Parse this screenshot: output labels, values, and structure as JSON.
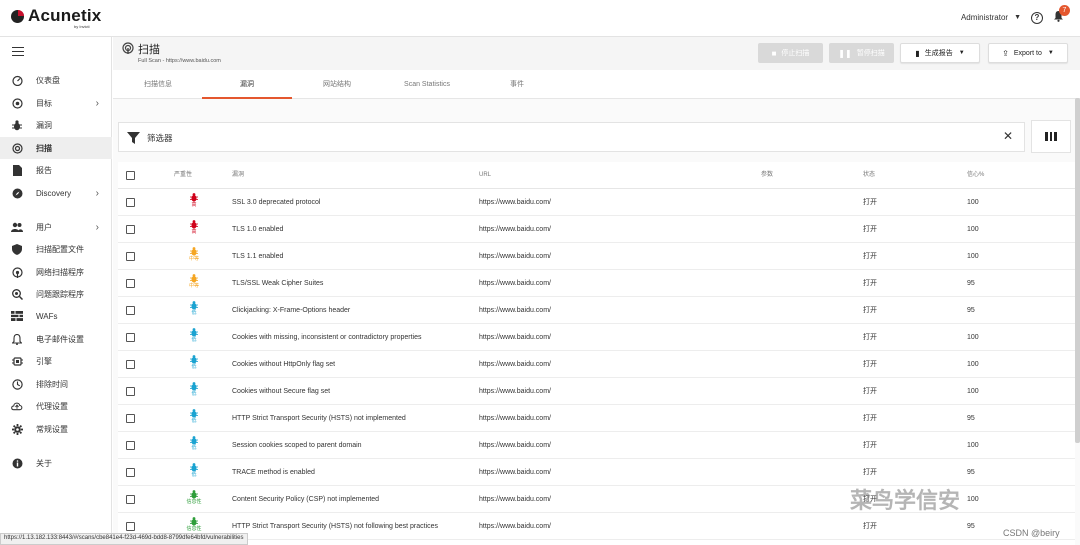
{
  "app": {
    "logo_text": "Acunetix",
    "logo_sub": "by Invicti",
    "user": "Administrator",
    "help_icon": "help-icon",
    "notifications": "7"
  },
  "sidebar": {
    "items": [
      {
        "label": "仪表盘",
        "icon": "dashboard-icon"
      },
      {
        "label": "目标",
        "icon": "target-icon",
        "arrow": "›"
      },
      {
        "label": "漏洞",
        "icon": "bug-icon"
      },
      {
        "label": "扫描",
        "icon": "scan-icon",
        "active": true
      },
      {
        "label": "报告",
        "icon": "report-icon"
      },
      {
        "label": "Discovery",
        "icon": "compass-icon",
        "arrow": "›"
      },
      {
        "label": "用户",
        "icon": "users-icon",
        "arrow": "›"
      },
      {
        "label": "扫描配置文件",
        "icon": "shield-icon"
      },
      {
        "label": "网络扫描程序",
        "icon": "network-scanner-icon"
      },
      {
        "label": "问题跟踪程序",
        "icon": "issue-tracker-icon"
      },
      {
        "label": "WAFs",
        "icon": "firewall-icon"
      },
      {
        "label": "电子邮件设置",
        "icon": "bell-icon"
      },
      {
        "label": "引擎",
        "icon": "engine-icon"
      },
      {
        "label": "排除时间",
        "icon": "clock-icon"
      },
      {
        "label": "代理设置",
        "icon": "cloud-proxy-icon"
      },
      {
        "label": "常规设置",
        "icon": "gear-icon"
      },
      {
        "label": "关于",
        "icon": "info-icon"
      }
    ]
  },
  "page": {
    "title": "扫描",
    "subtitle": "Full Scan - https://www.baidu.com",
    "buttons": {
      "stop": "停止扫描",
      "pause": "暂停扫描",
      "report": "生成报告",
      "export": "Export to"
    }
  },
  "tabs": [
    {
      "label": "扫描信息"
    },
    {
      "label": "漏洞",
      "active": true
    },
    {
      "label": "网站结构"
    },
    {
      "label": "Scan Statistics"
    },
    {
      "label": "事件"
    }
  ],
  "filter": {
    "label": "筛选器"
  },
  "table": {
    "headers": {
      "severity": "严重性",
      "vuln": "漏洞",
      "url": "URL",
      "params": "参数",
      "status": "状态",
      "confidence": "信心%"
    },
    "rows": [
      {
        "sev": "高",
        "color": "#d0021b",
        "vuln": "SSL 3.0 deprecated protocol",
        "url": "https://www.baidu.com/",
        "status": "打开",
        "conf": "100"
      },
      {
        "sev": "高",
        "color": "#d0021b",
        "vuln": "TLS 1.0 enabled",
        "url": "https://www.baidu.com/",
        "status": "打开",
        "conf": "100"
      },
      {
        "sev": "中等",
        "color": "#f5a623",
        "vuln": "TLS 1.1 enabled",
        "url": "https://www.baidu.com/",
        "status": "打开",
        "conf": "100"
      },
      {
        "sev": "中等",
        "color": "#f5a623",
        "vuln": "TLS/SSL Weak Cipher Suites",
        "url": "https://www.baidu.com/",
        "status": "打开",
        "conf": "95"
      },
      {
        "sev": "低",
        "color": "#1ba3d1",
        "vuln": "Clickjacking: X-Frame-Options header",
        "url": "https://www.baidu.com/",
        "status": "打开",
        "conf": "95"
      },
      {
        "sev": "低",
        "color": "#1ba3d1",
        "vuln": "Cookies with missing, inconsistent or contradictory properties",
        "url": "https://www.baidu.com/",
        "status": "打开",
        "conf": "100"
      },
      {
        "sev": "低",
        "color": "#1ba3d1",
        "vuln": "Cookies without HttpOnly flag set",
        "url": "https://www.baidu.com/",
        "status": "打开",
        "conf": "100"
      },
      {
        "sev": "低",
        "color": "#1ba3d1",
        "vuln": "Cookies without Secure flag set",
        "url": "https://www.baidu.com/",
        "status": "打开",
        "conf": "100"
      },
      {
        "sev": "低",
        "color": "#1ba3d1",
        "vuln": "HTTP Strict Transport Security (HSTS) not implemented",
        "url": "https://www.baidu.com/",
        "status": "打开",
        "conf": "95"
      },
      {
        "sev": "低",
        "color": "#1ba3d1",
        "vuln": "Session cookies scoped to parent domain",
        "url": "https://www.baidu.com/",
        "status": "打开",
        "conf": "100"
      },
      {
        "sev": "低",
        "color": "#1ba3d1",
        "vuln": "TRACE method is enabled",
        "url": "https://www.baidu.com/",
        "status": "打开",
        "conf": "95"
      },
      {
        "sev": "信息性",
        "color": "#2e9e3a",
        "vuln": "Content Security Policy (CSP) not implemented",
        "url": "https://www.baidu.com/",
        "status": "打开",
        "conf": "100"
      },
      {
        "sev": "信息性",
        "color": "#2e9e3a",
        "vuln": "HTTP Strict Transport Security (HSTS) not following best practices",
        "url": "https://www.baidu.com/",
        "status": "打开",
        "conf": "95"
      }
    ]
  },
  "status_url": "https://1.13.182.133:8443/#/scans/cbe841e4-f23d-469d-bdd8-8799dfe64bfd/vulnerabilities",
  "watermark": {
    "main": "菜鸟学信安",
    "csdn": "CSDN @beiry"
  }
}
